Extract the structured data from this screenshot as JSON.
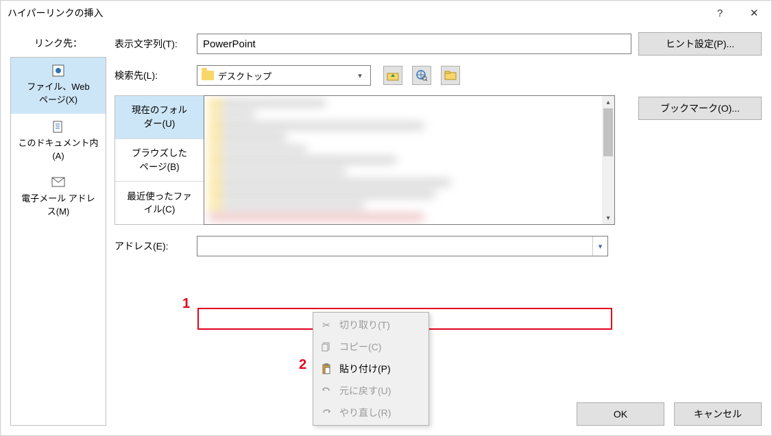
{
  "title": "ハイパーリンクの挿入",
  "link_to_label": "リンク先：",
  "link_targets": [
    {
      "label": "ファイル、Web\nページ(X)",
      "selected": true
    },
    {
      "label": "このドキュメント内\n(A)",
      "selected": false
    },
    {
      "label": "電子メール アドレ\nス(M)",
      "selected": false
    }
  ],
  "display_text": {
    "label": "表示文字列(T):",
    "value": "PowerPoint"
  },
  "hint_button": "ヒント設定(P)...",
  "search_in": {
    "label": "検索先(L):",
    "value": "デスクトップ"
  },
  "bookmark_button": "ブックマーク(O)...",
  "browser_tabs": [
    {
      "label": "現在のフォル\nダー(U)",
      "selected": true
    },
    {
      "label": "ブラウズした\nページ(B)",
      "selected": false
    },
    {
      "label": "最近使ったファ\nイル(C)",
      "selected": false
    }
  ],
  "address": {
    "label": "アドレス(E):",
    "value": ""
  },
  "context_menu": [
    {
      "label": "切り取り(T)",
      "enabled": false,
      "icon": "cut"
    },
    {
      "label": "コピー(C)",
      "enabled": false,
      "icon": "copy"
    },
    {
      "label": "貼り付け(P)",
      "enabled": true,
      "icon": "paste"
    },
    {
      "label": "元に戻す(U)",
      "enabled": false,
      "icon": "undo"
    },
    {
      "label": "やり直し(R)",
      "enabled": false,
      "icon": "redo"
    }
  ],
  "annotations": {
    "1": "1",
    "2": "2"
  },
  "footer": {
    "ok": "OK",
    "cancel": "キャンセル"
  },
  "titlebar_help": "?",
  "titlebar_close": "✕"
}
